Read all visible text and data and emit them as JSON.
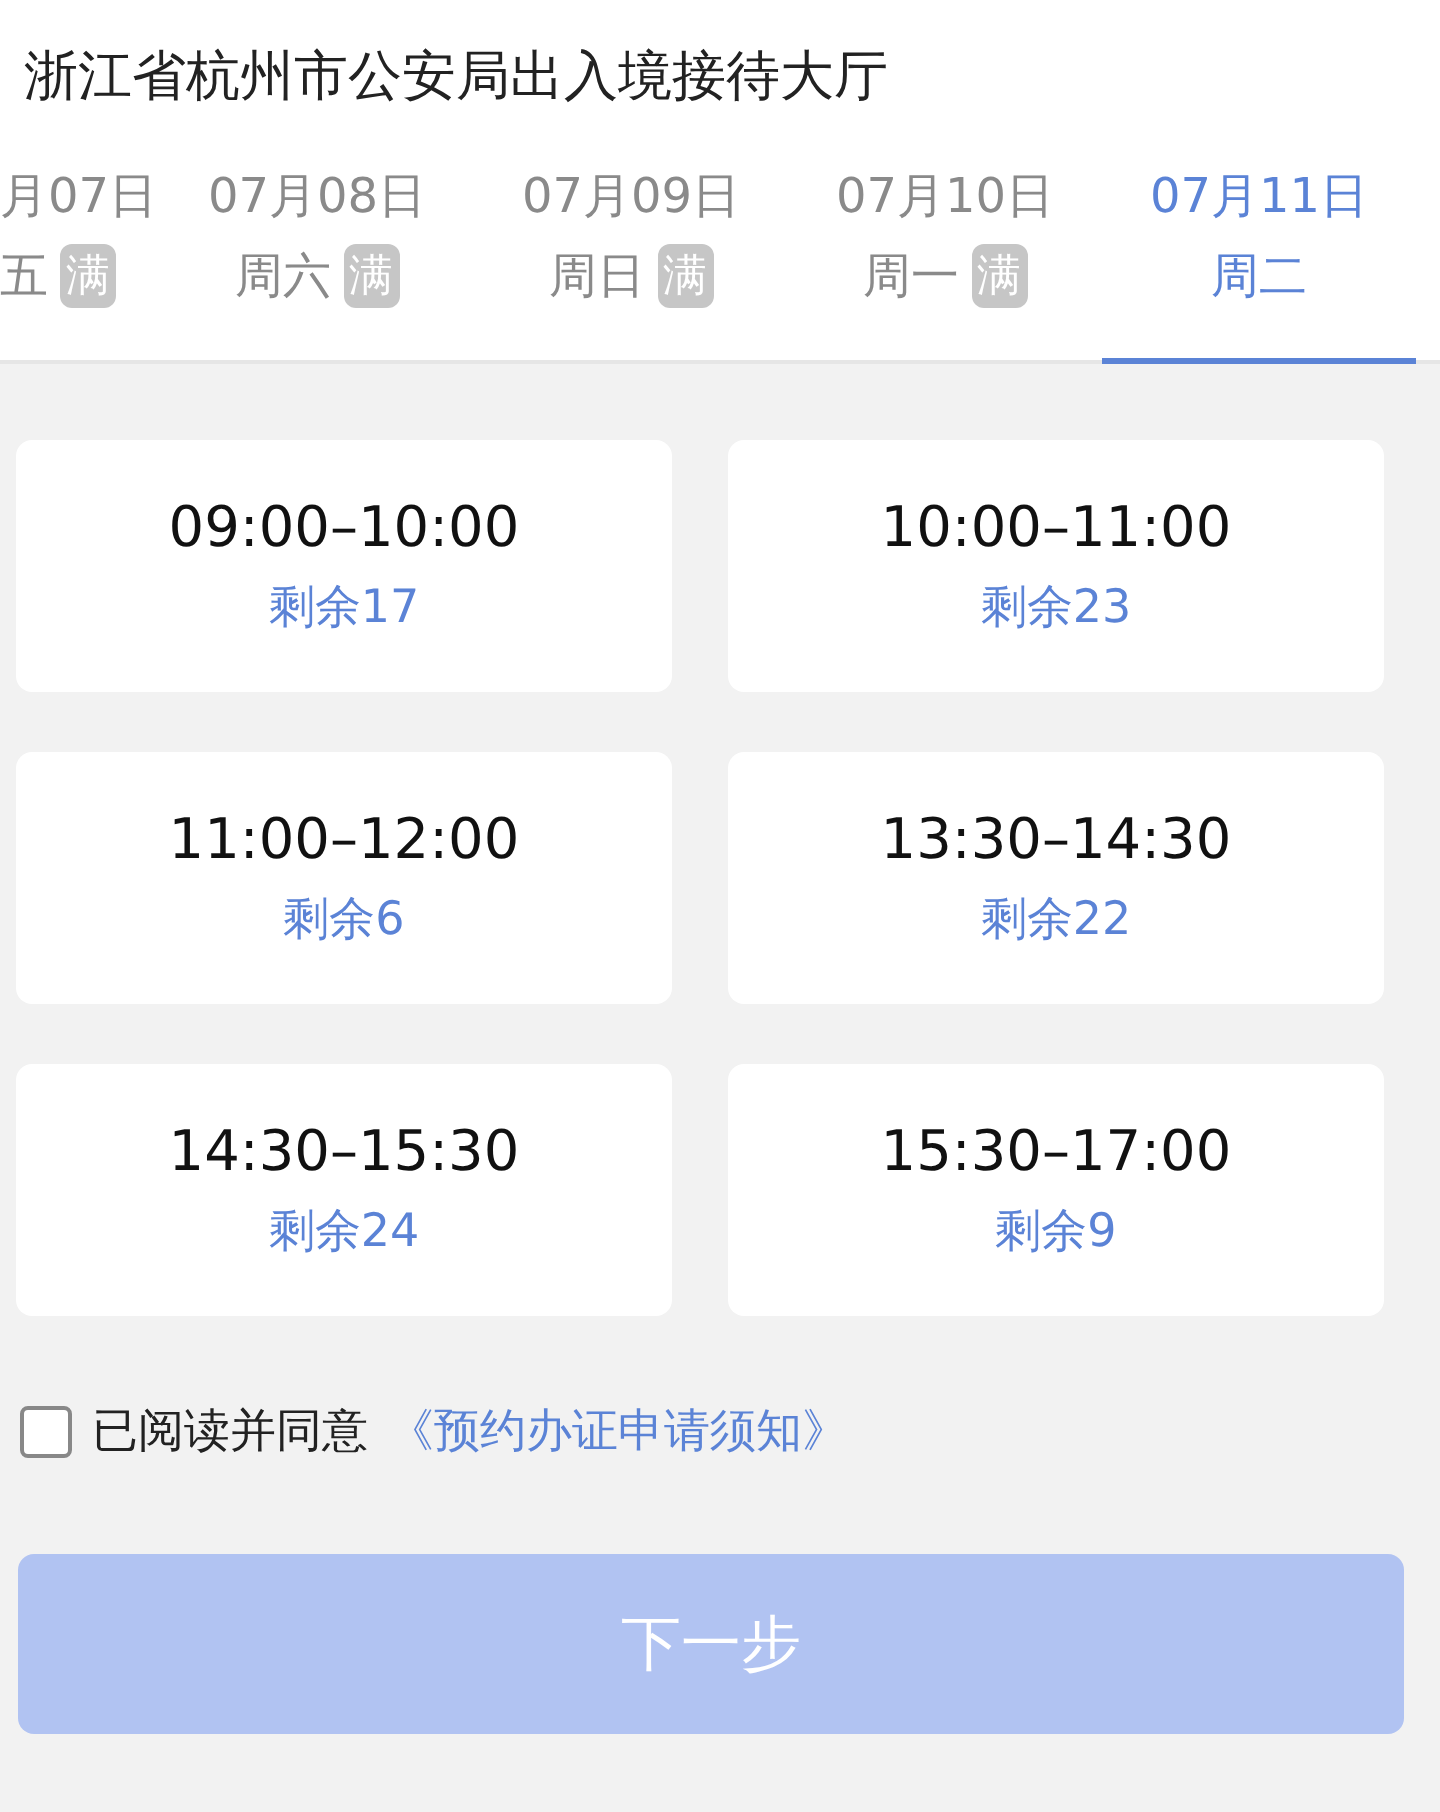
{
  "title": "浙江省杭州市公安局出入境接待大厅",
  "date_tabs": [
    {
      "date": "月07日",
      "weekday": "五",
      "badge": "满",
      "selected": false
    },
    {
      "date": "07月08日",
      "weekday": "周六",
      "badge": "满",
      "selected": false
    },
    {
      "date": "07月09日",
      "weekday": "周日",
      "badge": "满",
      "selected": false
    },
    {
      "date": "07月10日",
      "weekday": "周一",
      "badge": "满",
      "selected": false
    },
    {
      "date": "07月11日",
      "weekday": "周二",
      "selected": true
    }
  ],
  "slots": [
    {
      "time": "09:00–10:00",
      "remaining": "剩余17"
    },
    {
      "time": "10:00–11:00",
      "remaining": "剩余23"
    },
    {
      "time": "11:00–12:00",
      "remaining": "剩余6"
    },
    {
      "time": "13:30–14:30",
      "remaining": "剩余22"
    },
    {
      "time": "14:30–15:30",
      "remaining": "剩余24"
    },
    {
      "time": "15:30–17:00",
      "remaining": "剩余9"
    }
  ],
  "agreement": {
    "checked": false,
    "label": "已阅读并同意",
    "link": "《预约办证申请须知》"
  },
  "next_button": {
    "label": "下一步",
    "disabled": true
  }
}
